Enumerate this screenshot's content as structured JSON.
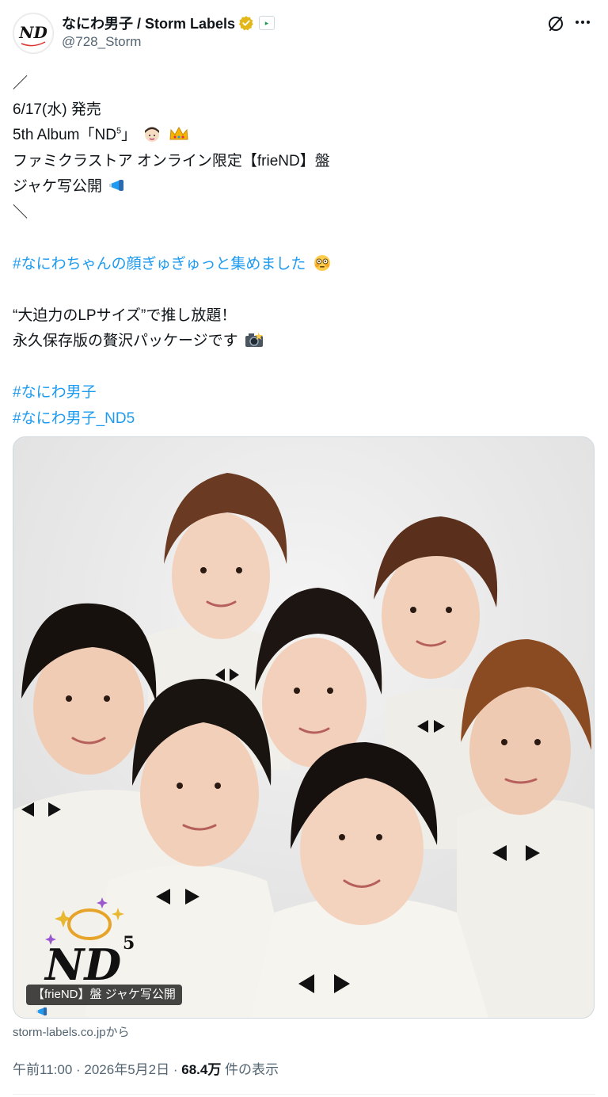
{
  "account": {
    "display_name": "なにわ男子 / Storm Labels",
    "handle": "@728_Storm",
    "avatar_text": "ND"
  },
  "post": {
    "lines": [
      "／",
      "6/17(水) 発売",
      "5th Album「ND",
      "5",
      "」",
      "ファミクラストア オンライン限定【frieND】盤",
      "ジャケ写公開",
      "＼",
      "#なにわちゃんの顔ぎゅぎゅっと集めました",
      "“大迫力のLPサイズ”で推し放題！",
      "永久保存版の贅沢パッケージです",
      "#なにわ男子",
      "#なにわ男子_ND5"
    ]
  },
  "media": {
    "caption": "【frieND】盤 ジャケ写公開",
    "logo_text": "ND",
    "logo_sup": "5"
  },
  "card": {
    "source": "storm-labels.co.jpから"
  },
  "meta": {
    "time": "午前11:00",
    "sep1": " · ",
    "date": "2026年5月2日",
    "sep2": " · ",
    "views": "68.4万",
    "views_suffix": " 件の表示"
  },
  "colors": {
    "link": "#1d9bf0",
    "verified": "#e2b719",
    "text": "#0f1419",
    "muted": "#536471"
  },
  "icons": [
    "verified-badge-icon",
    "affiliate-badge-icon",
    "grok-icon",
    "more-icon",
    "boy-emoji-icon",
    "crown-emoji-icon",
    "megaphone-emoji-icon",
    "flushed-face-emoji-icon",
    "camera-flash-emoji-icon"
  ]
}
